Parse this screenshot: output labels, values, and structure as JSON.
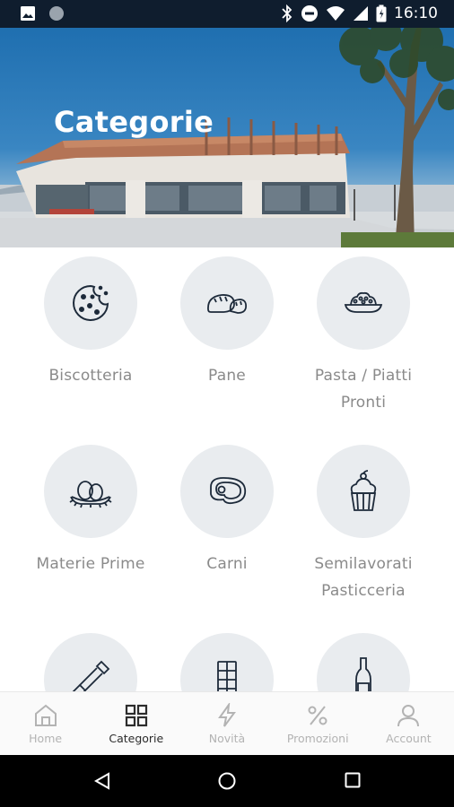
{
  "status_bar": {
    "time": "16:10",
    "icons": [
      "image-icon",
      "circle-icon",
      "bluetooth-icon",
      "dnd-icon",
      "wifi-icon",
      "signal-icon",
      "battery-icon"
    ]
  },
  "hero": {
    "title": "Categorie"
  },
  "categories": [
    {
      "label": "Biscotteria",
      "icon": "cookie-icon"
    },
    {
      "label": "Pane",
      "icon": "bread-icon"
    },
    {
      "label_line1": "Pasta / Piatti",
      "label_line2": "Pronti",
      "icon": "pasta-plate-icon"
    },
    {
      "label": "Materie Prime",
      "icon": "eggs-nest-icon"
    },
    {
      "label": "Carni",
      "icon": "steak-icon"
    },
    {
      "label_line1": "Semilavorati",
      "label_line2": "Pasticceria",
      "icon": "cupcake-icon"
    },
    {
      "label": "",
      "icon": "rolling-pin-icon"
    },
    {
      "label": "",
      "icon": "chocolate-bar-icon"
    },
    {
      "label": "",
      "icon": "bottle-icon"
    }
  ],
  "bottom_nav": {
    "items": [
      {
        "label": "Home",
        "icon": "home-icon"
      },
      {
        "label": "Categorie",
        "icon": "grid-icon",
        "active": true
      },
      {
        "label": "Novità",
        "icon": "lightning-icon"
      },
      {
        "label": "Promozioni",
        "icon": "percent-icon"
      },
      {
        "label": "Account",
        "icon": "user-icon"
      }
    ]
  },
  "colors": {
    "status_bar": "#0f1d2e",
    "circle_bg": "#e9ecef",
    "label": "#8a8a8a",
    "nav_active": "#2c2c2c",
    "nav_inactive": "#b3b3b3"
  }
}
